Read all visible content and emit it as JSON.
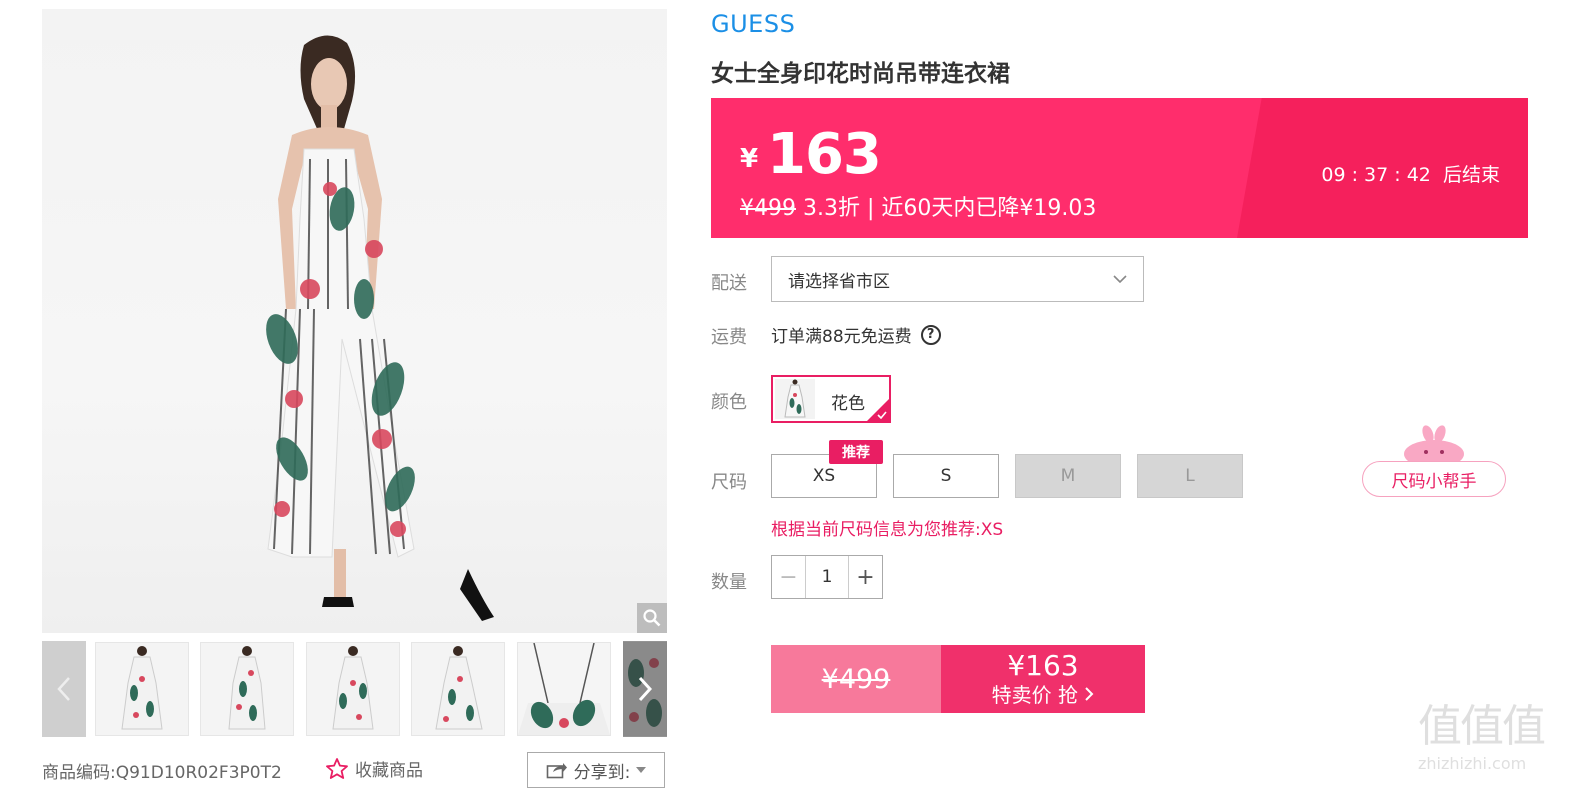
{
  "gallery": {
    "product_code_label": "商品编码:",
    "product_code": "Q91D10R02F3P0T2",
    "favorite_label": "收藏商品",
    "share_label": "分享到:",
    "thumbnail_count": 6
  },
  "product": {
    "brand": "GUESS",
    "title": "女士全身印花时尚吊带连衣裙"
  },
  "price": {
    "currency": "¥",
    "current": "163",
    "original": "¥499",
    "discount": "3.3折",
    "separator": "|",
    "drop_note": "近60天内已降¥19.03",
    "countdown": "09 : 37 : 42",
    "countdown_suffix": "后结束"
  },
  "delivery": {
    "label": "配送",
    "placeholder": "请选择省市区"
  },
  "shipping": {
    "label": "运费",
    "text": "订单满88元免运费"
  },
  "color": {
    "label": "颜色",
    "selected": "花色"
  },
  "size": {
    "label": "尺码",
    "options": [
      "XS",
      "S",
      "M",
      "L"
    ],
    "unavailable": [
      "M",
      "L"
    ],
    "recommended_tag": "推荐",
    "recommend_text": "根据当前尺码信息为您推荐:XS",
    "helper_label": "尺码小帮手"
  },
  "quantity": {
    "label": "数量",
    "value": "1",
    "minus": "−",
    "plus": "+"
  },
  "buy": {
    "original_price": "¥499",
    "sale_price": "¥163",
    "cta": "特卖价 抢"
  },
  "watermark": {
    "glyphs": "值值值",
    "site": "zhizhizhi.com"
  },
  "colors": {
    "brand_blue": "#1b8fe6",
    "accent_pink": "#e91e63",
    "banner_pink": "#ff2d6c",
    "button_pink_light": "#f7799b",
    "button_pink": "#f0306b"
  }
}
